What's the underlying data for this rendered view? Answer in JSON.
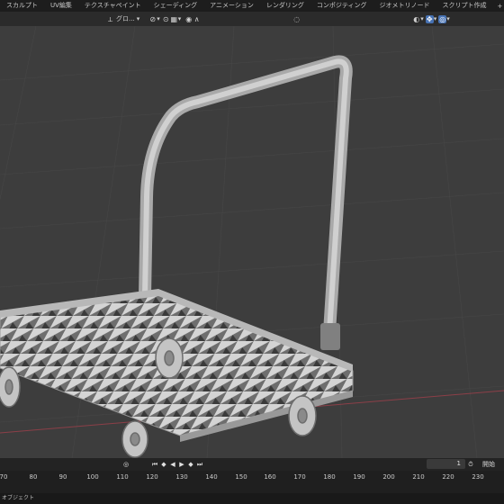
{
  "workspace_tabs": [
    "スカルプト",
    "UV編集",
    "テクスチャペイント",
    "シェーディング",
    "アニメーション",
    "レンダリング",
    "コンポジティング",
    "ジオメトリノード",
    "スクリプト作成"
  ],
  "add_workspace_label": "+",
  "toolbar": {
    "orientation_label": "グロ...",
    "chevron": "▾"
  },
  "timeline": {
    "current_frame": "1",
    "start_label": "開始",
    "ruler_ticks": [
      "70",
      "80",
      "90",
      "100",
      "110",
      "120",
      "130",
      "140",
      "150",
      "160",
      "170",
      "180",
      "190",
      "200",
      "210",
      "220",
      "230"
    ]
  },
  "statusbar": {
    "text": "オブジェクト"
  },
  "colors": {
    "accent": "#4772b3",
    "header": "#1d1d1d",
    "viewport": "#3d3d3d"
  }
}
